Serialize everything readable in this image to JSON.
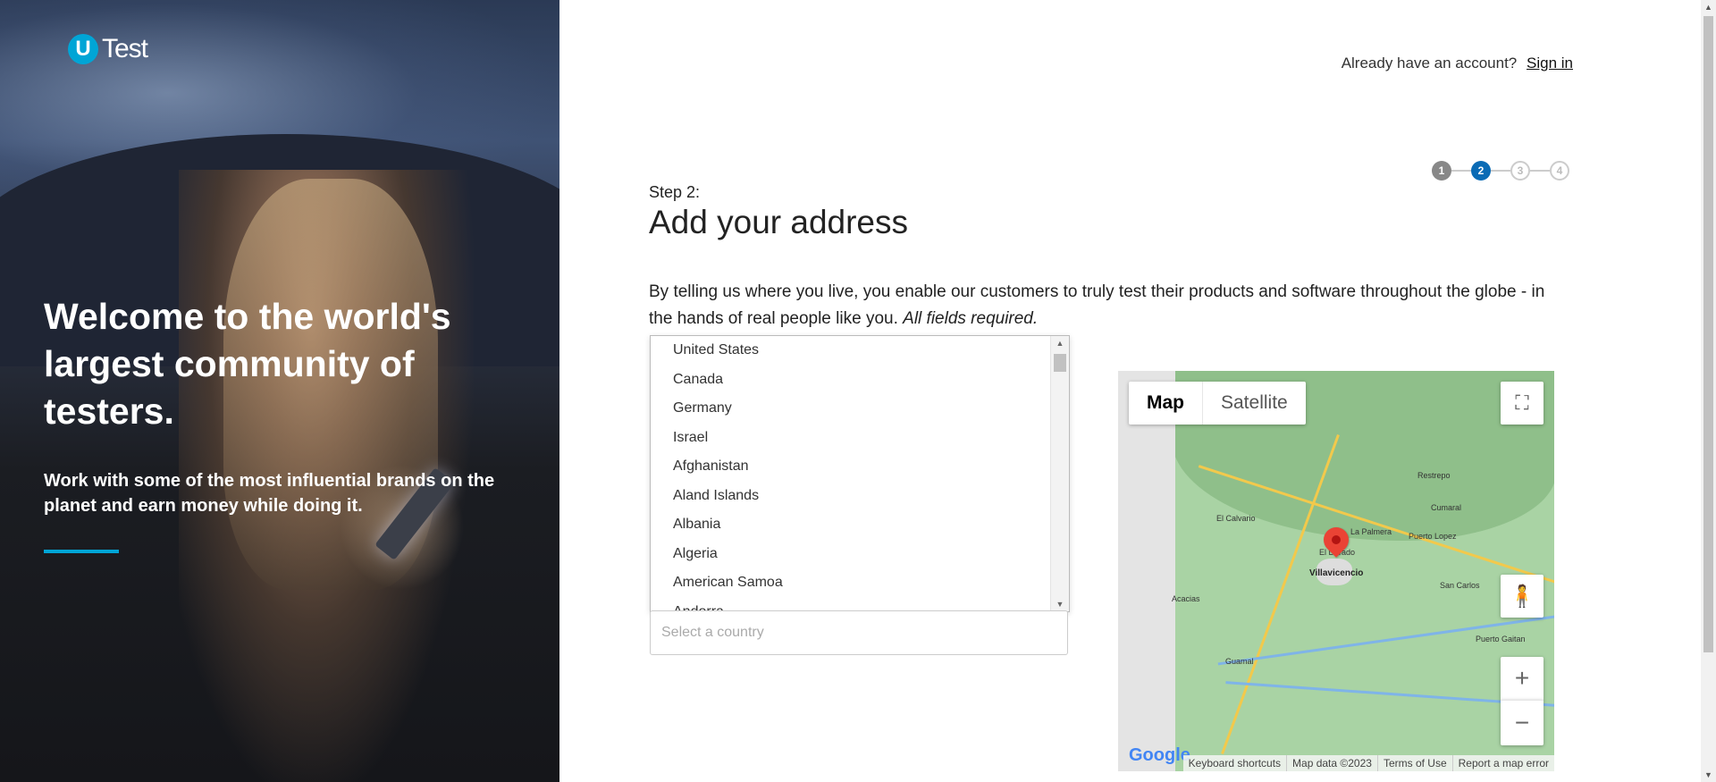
{
  "hero": {
    "logo_mark": "U",
    "logo_text": "Test",
    "headline": "Welcome to the world's largest community of testers.",
    "subheadline": "Work with some of the most influential brands on the planet and earn money while doing it.",
    "accent_color": "#00a5d6"
  },
  "header": {
    "already_text": "Already have an account?",
    "signin_label": "Sign in"
  },
  "stepper": {
    "steps": [
      "1",
      "2",
      "3",
      "4"
    ],
    "current": 2,
    "active_color": "#0a6bb5"
  },
  "form": {
    "step_label": "Step 2:",
    "title": "Add your address",
    "description": "By telling us where you live, you enable our customers to truly test their products and software throughout the globe - in the hands of real people like you.",
    "required_note": "All fields required.",
    "country_placeholder": "Select a country",
    "country_options": [
      "United States",
      "Canada",
      "Germany",
      "Israel",
      "Afghanistan",
      "Aland Islands",
      "Albania",
      "Algeria",
      "American Samoa",
      "Andorra"
    ]
  },
  "map": {
    "type_options": [
      "Map",
      "Satellite"
    ],
    "selected_type": "Map",
    "marker_label": "Villavicencio",
    "places": [
      "Restrepo",
      "El Calvario",
      "Cumaral",
      "La Palmera",
      "Puerto Lopez",
      "El Dorado",
      "Acacias",
      "San Carlos",
      "Guamal",
      "Puerto Gaitan"
    ],
    "logo": "Google",
    "attribution": [
      "Keyboard shortcuts",
      "Map data ©2023",
      "Terms of Use",
      "Report a map error"
    ],
    "icons": {
      "fullscreen": "fullscreen-icon",
      "pegman": "pegman-icon",
      "zoom_in": "zoom-in-icon",
      "zoom_out": "zoom-out-icon",
      "marker": "map-marker-icon"
    }
  }
}
